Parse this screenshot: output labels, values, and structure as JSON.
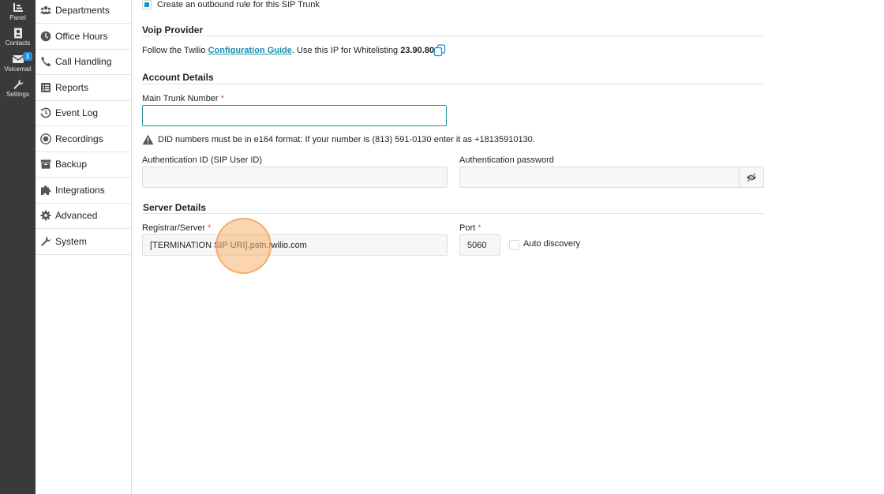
{
  "rail": {
    "panel_label": "Panel",
    "contacts_label": "Contacts",
    "voicemail_label": "Voicemail",
    "voicemail_badge": "1",
    "settings_label": "Settings"
  },
  "nav": {
    "items": [
      {
        "label": "Departments",
        "icon": "people-icon"
      },
      {
        "label": "Office Hours",
        "icon": "clock-icon"
      },
      {
        "label": "Call Handling",
        "icon": "phone-icon"
      },
      {
        "label": "Reports",
        "icon": "list-icon"
      },
      {
        "label": "Event Log",
        "icon": "history-icon"
      },
      {
        "label": "Recordings",
        "icon": "record-icon"
      },
      {
        "label": "Backup",
        "icon": "archive-icon"
      },
      {
        "label": "Integrations",
        "icon": "puzzle-icon"
      },
      {
        "label": "Advanced",
        "icon": "gear-icon"
      },
      {
        "label": "System",
        "icon": "wrench-icon"
      }
    ]
  },
  "form": {
    "outbound_rule_label": "Create an outbound rule for this SIP Trunk",
    "outbound_rule_checked": true,
    "voip": {
      "title": "Voip Provider",
      "text_before": "Follow the Twilio",
      "guide_link": "Configuration Guide",
      "text_after": ". Use this IP for Whitelisting",
      "ip": "23.90.80.6"
    },
    "account": {
      "title": "Account Details",
      "main_trunk_label": "Main Trunk Number",
      "required_mark": "*",
      "main_trunk_value": "",
      "did_warning": "DID numbers must be in e164 format: If your number is (813) 591-0130 enter it as +18135910130.",
      "auth_id_label": "Authentication ID (SIP User ID)",
      "auth_id_value": "",
      "auth_password_label": "Authentication password",
      "auth_password_value": ""
    },
    "server": {
      "title": "Server Details",
      "registrar_label": "Registrar/Server",
      "registrar_value": "[TERMINATION SIP URI].pstn.twilio.com",
      "port_label": "Port",
      "port_value": "5060",
      "auto_discovery_label": "Auto discovery",
      "auto_discovery_checked": false
    }
  },
  "colors": {
    "accent": "#1e8fd6",
    "link": "#1a8fb0",
    "required": "#d9534f",
    "rail_bg": "#3a3a3a"
  }
}
